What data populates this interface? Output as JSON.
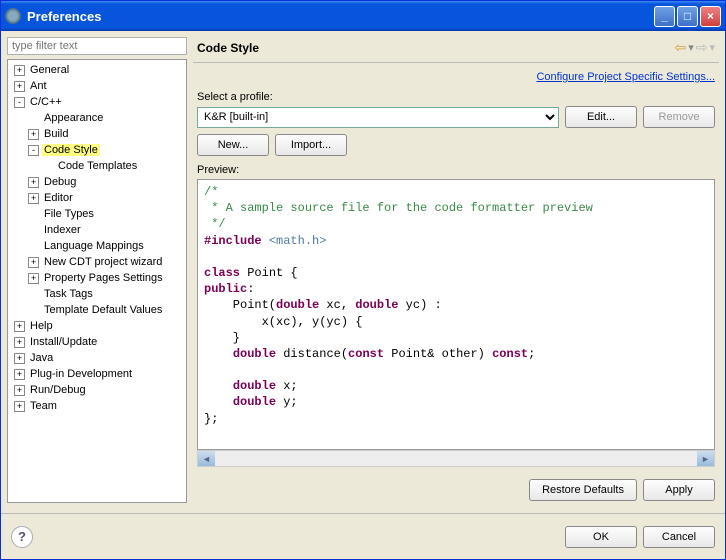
{
  "window": {
    "title": "Preferences"
  },
  "filter": {
    "placeholder": "type filter text"
  },
  "tree": {
    "items": [
      {
        "label": "General",
        "depth": 0,
        "expand": "+"
      },
      {
        "label": "Ant",
        "depth": 0,
        "expand": "+"
      },
      {
        "label": "C/C++",
        "depth": 0,
        "expand": "-"
      },
      {
        "label": "Appearance",
        "depth": 1,
        "expand": ""
      },
      {
        "label": "Build",
        "depth": 1,
        "expand": "+"
      },
      {
        "label": "Code Style",
        "depth": 1,
        "expand": "-",
        "highlight": true
      },
      {
        "label": "Code Templates",
        "depth": 2,
        "expand": ""
      },
      {
        "label": "Debug",
        "depth": 1,
        "expand": "+"
      },
      {
        "label": "Editor",
        "depth": 1,
        "expand": "+"
      },
      {
        "label": "File Types",
        "depth": 1,
        "expand": ""
      },
      {
        "label": "Indexer",
        "depth": 1,
        "expand": ""
      },
      {
        "label": "Language Mappings",
        "depth": 1,
        "expand": ""
      },
      {
        "label": "New CDT project wizard",
        "depth": 1,
        "expand": "+"
      },
      {
        "label": "Property Pages Settings",
        "depth": 1,
        "expand": "+"
      },
      {
        "label": "Task Tags",
        "depth": 1,
        "expand": ""
      },
      {
        "label": "Template Default Values",
        "depth": 1,
        "expand": ""
      },
      {
        "label": "Help",
        "depth": 0,
        "expand": "+"
      },
      {
        "label": "Install/Update",
        "depth": 0,
        "expand": "+"
      },
      {
        "label": "Java",
        "depth": 0,
        "expand": "+"
      },
      {
        "label": "Plug-in Development",
        "depth": 0,
        "expand": "+"
      },
      {
        "label": "Run/Debug",
        "depth": 0,
        "expand": "+"
      },
      {
        "label": "Team",
        "depth": 0,
        "expand": "+"
      }
    ]
  },
  "page": {
    "heading": "Code Style",
    "config_link": "Configure Project Specific Settings...",
    "select_profile_label": "Select a profile:",
    "profile_selected": "K&R [built-in]",
    "edit_btn": "Edit...",
    "remove_btn": "Remove",
    "new_btn": "New...",
    "import_btn": "Import...",
    "preview_label": "Preview:",
    "restore_btn": "Restore Defaults",
    "apply_btn": "Apply"
  },
  "preview": {
    "code_html": "<span class=\"c-comment\">/*\n * A sample source file for the code formatter preview\n */</span>\n<span class=\"c-keyword\">#include</span> <span class=\"c-include\">&lt;math.h&gt;</span>\n\n<span class=\"c-keyword\">class</span> Point {\n<span class=\"c-keyword\">public</span>:\n    Point(<span class=\"c-keyword\">double</span> xc, <span class=\"c-keyword\">double</span> yc) :\n        x(xc), y(yc) {\n    }\n    <span class=\"c-keyword\">double</span> distance(<span class=\"c-keyword\">const</span> Point&amp; other) <span class=\"c-keyword\">const</span>;\n\n    <span class=\"c-keyword\">double</span> x;\n    <span class=\"c-keyword\">double</span> y;\n};"
  },
  "footer": {
    "ok": "OK",
    "cancel": "Cancel"
  }
}
